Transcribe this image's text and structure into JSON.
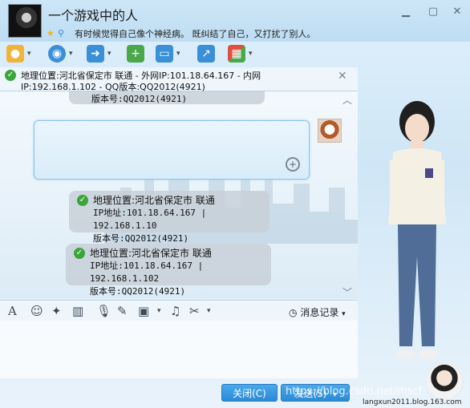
{
  "header": {
    "contact_name": "一个游戏中的人",
    "signature": "有时候觉得自己像个神经病。 既纠结了自己，又打扰了别人。",
    "window_buttons": [
      "minimize-icon",
      "restore-icon",
      "close-icon"
    ]
  },
  "toolbar": {
    "tools": [
      {
        "name": "voice-call",
        "icon": "microphone-icon",
        "color": "#f0b43a"
      },
      {
        "name": "video-call",
        "icon": "webcam-icon",
        "color": "#3a8fd9"
      },
      {
        "name": "send-file",
        "icon": "folder-arrow-icon",
        "color": "#3a8fd9"
      },
      {
        "name": "create-discussion",
        "icon": "add-chat-icon",
        "color": "#4aa84a"
      },
      {
        "name": "remote-assist",
        "icon": "monitor-icon",
        "color": "#3a8fd9"
      },
      {
        "name": "share-screen",
        "icon": "screen-share-icon",
        "color": "#3a8fd9"
      },
      {
        "name": "apps",
        "icon": "app-grid-icon",
        "color": "#e24f3d"
      }
    ]
  },
  "notice": {
    "line1": "地理位置:河北省保定市 联通 - 外网IP:101.18.64.167 - 内网",
    "line2": "IP:192.168.1.102 - QQ版本:QQ2012(4921)"
  },
  "chat": {
    "partial_version": "版本号:QQ2012(4921)",
    "messages": [
      {
        "location": "地理位置:河北省保定市 联通",
        "ip": "IP地址:101.18.64.167 | 192.168.1.10",
        "version": "版本号:QQ2012(4921)"
      },
      {
        "location": "地理位置:河北省保定市 联通",
        "ip": "IP地址:101.18.64.167 | 192.168.1.102",
        "version": "版本号:QQ2012(4921)"
      }
    ]
  },
  "format_bar": {
    "history_label": "消息记录"
  },
  "buttons": {
    "close": "关闭(C)",
    "send": "发送(S)"
  },
  "watermark": "https://blog.csdn.net/mscf",
  "footer_url": "langxun2011.blog.163.com"
}
